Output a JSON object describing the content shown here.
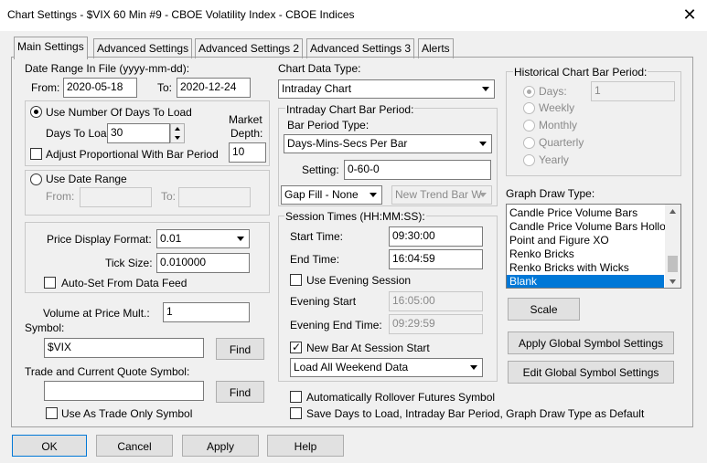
{
  "window": {
    "title": "Chart Settings - $VIX  60 Min   #9 - CBOE Volatility Index - CBOE Indices",
    "close": "✕"
  },
  "tabs": [
    "Main Settings",
    "Advanced Settings",
    "Advanced Settings 2",
    "Advanced Settings 3",
    "Alerts"
  ],
  "date_range": {
    "label": "Date Range In File (yyyy-mm-dd):",
    "from_label": "From:",
    "from_value": "2020-05-18",
    "to_label": "To:",
    "to_value": "2020-12-24"
  },
  "days_group": {
    "use_days_label": "Use Number Of Days To Load",
    "days_to_load_label": "Days To Load:",
    "days_to_load_value": "30",
    "market_depth_label_1": "Market",
    "market_depth_label_2": "Depth:",
    "market_depth_value": "10",
    "adjust_label": "Adjust Proportional With Bar Period"
  },
  "date_range_group": {
    "use_date_range_label": "Use Date Range",
    "from_label": "From:",
    "to_label": "To:"
  },
  "price_group": {
    "price_format_label": "Price Display Format:",
    "price_format_value": "0.01",
    "tick_size_label": "Tick Size:",
    "tick_size_value": "0.010000",
    "auto_set_label": "Auto-Set From Data Feed"
  },
  "volume_mult": {
    "label": "Volume at Price Mult.:",
    "value": "1"
  },
  "symbol": {
    "label": "Symbol:",
    "value": "$VIX",
    "find": "Find"
  },
  "trade_symbol": {
    "label": "Trade and Current Quote Symbol:",
    "value": "",
    "find": "Find",
    "trade_only_label": "Use As Trade Only Symbol"
  },
  "chart_data_type": {
    "label": "Chart Data Type:",
    "value": "Intraday Chart"
  },
  "intraday_period": {
    "label": "Intraday Chart Bar Period:",
    "bar_period_type_label": "Bar Period Type:",
    "bar_period_type_value": "Days-Mins-Secs Per Bar",
    "setting_label": "Setting:",
    "setting_value": "0-60-0",
    "gap_fill_value": "Gap Fill - None",
    "new_trend_value": "New Trend Bar W"
  },
  "session": {
    "label": "Session Times (HH:MM:SS):",
    "start_label": "Start Time:",
    "start_value": "09:30:00",
    "end_label": "End Time:",
    "end_value": "16:04:59",
    "use_evening_label": "Use Evening Session",
    "evening_start_label": "Evening Start",
    "evening_start_value": "16:05:00",
    "evening_end_label": "Evening End Time:",
    "evening_end_value": "09:29:59",
    "new_bar_label": "New Bar At Session Start",
    "weekend_value": "Load All Weekend Data"
  },
  "rollover_label": "Automatically Rollover Futures Symbol",
  "save_days_label": "Save Days to Load, Intraday Bar Period, Graph Draw Type as Default",
  "historical": {
    "label": "Historical Chart Bar Period:",
    "options": [
      "Days:",
      "Weekly",
      "Monthly",
      "Quarterly",
      "Yearly"
    ],
    "days_value": "1"
  },
  "graph_draw": {
    "label": "Graph Draw Type:",
    "items": [
      "Candle Price Volume Bars",
      "Candle Price Volume Bars Hollo",
      "Point and Figure XO",
      "Renko Bricks",
      "Renko Bricks with Wicks",
      "Blank"
    ]
  },
  "buttons": {
    "scale": "Scale",
    "apply_global": "Apply Global Symbol Settings",
    "edit_global": "Edit Global Symbol Settings",
    "ok": "OK",
    "cancel": "Cancel",
    "apply": "Apply",
    "help": "Help"
  },
  "colors": {
    "selection": "#0078d7",
    "face": "#f0f0f0",
    "border": "#a0a0a0"
  }
}
